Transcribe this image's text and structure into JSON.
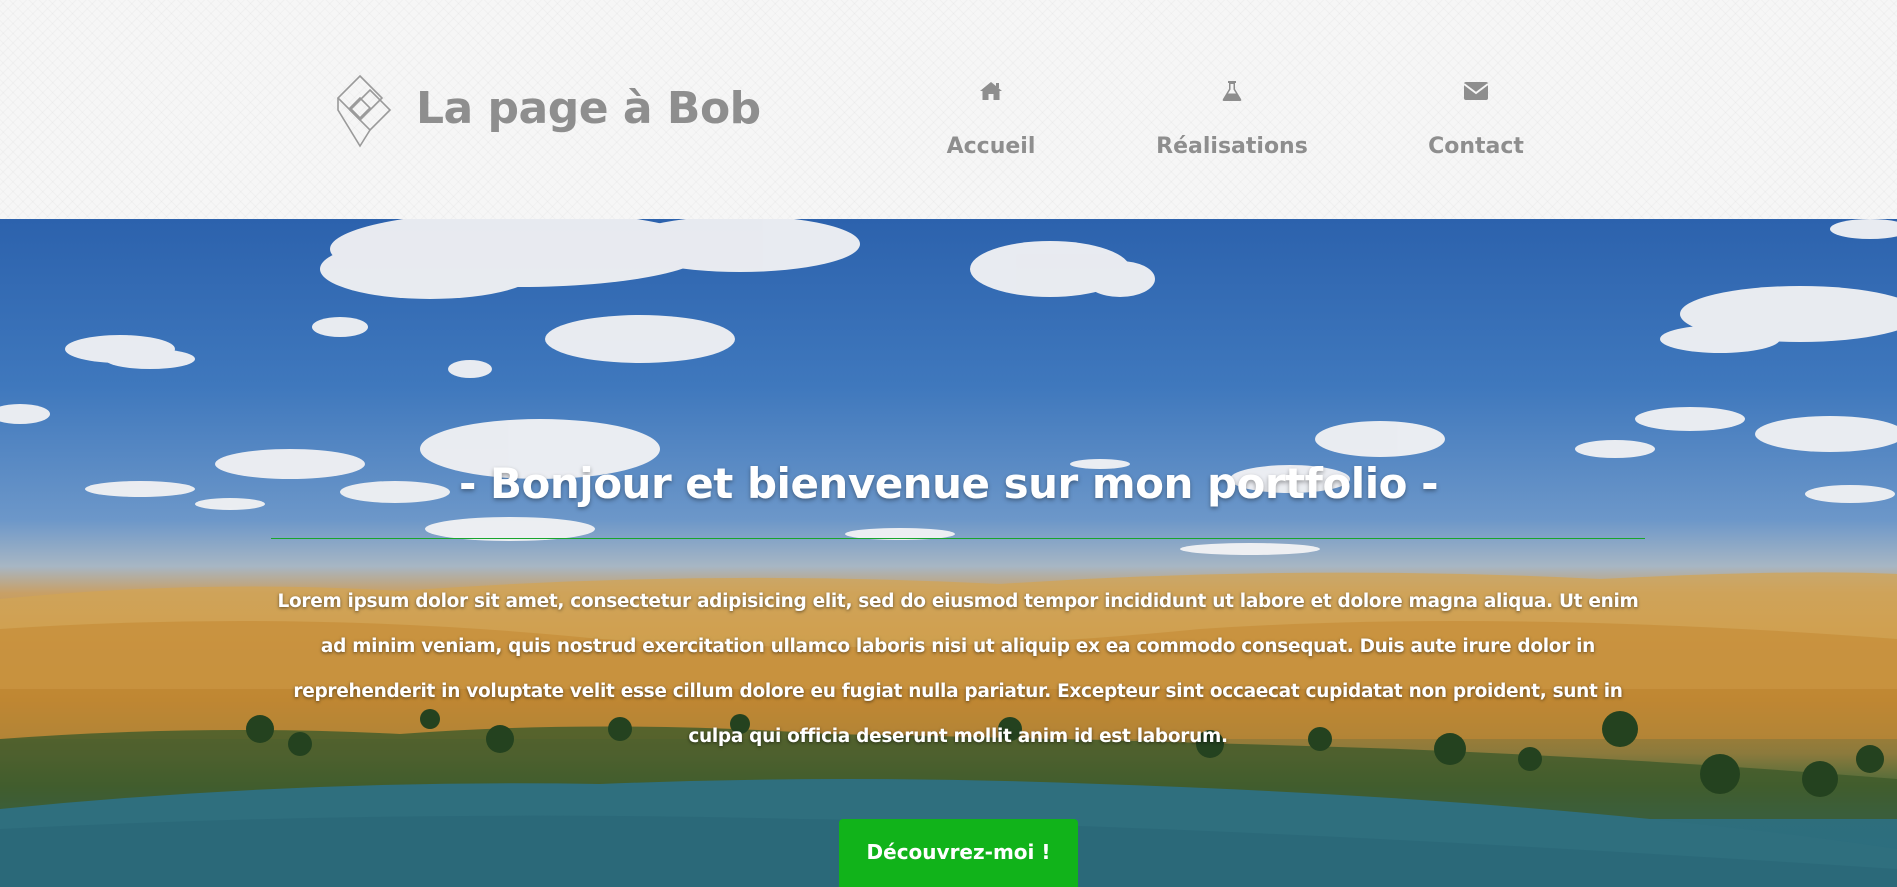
{
  "header": {
    "site_title": "La page à Bob",
    "logo_icon": "diamond-logo-icon"
  },
  "nav": {
    "items": [
      {
        "label": "Accueil",
        "icon": "home-icon"
      },
      {
        "label": "Réalisations",
        "icon": "flask-icon"
      },
      {
        "label": "Contact",
        "icon": "envelope-icon"
      }
    ]
  },
  "hero": {
    "title": "- Bonjour et bienvenue sur mon portfolio -",
    "text": "Lorem ipsum dolor sit amet, consectetur adipisicing elit, sed do eiusmod tempor incididunt ut labore et dolore magna aliqua. Ut enim ad minim veniam, quis nostrud exercitation ullamco laboris nisi ut aliquip ex ea commodo consequat. Duis aute irure dolor in reprehenderit in voluptate velit esse cillum dolore eu fugiat nulla pariatur. Excepteur sint occaecat cupidatat non proident, sunt in culpa qui officia deserunt mollit anim id est laborum.",
    "cta_label": "Découvrez-moi !",
    "background": "desert-oasis-photo"
  },
  "colors": {
    "header_text": "#8e8e8e",
    "accent_green": "#11b31a",
    "rule_green": "#18a52d",
    "hero_text": "#ffffff"
  }
}
